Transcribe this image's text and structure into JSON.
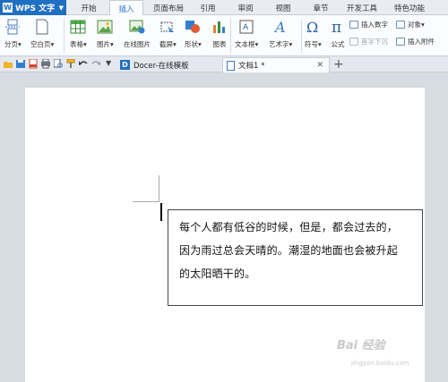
{
  "app": {
    "logo_text": "W",
    "name": "WPS 文字"
  },
  "menu_tabs": [
    "开始",
    "插入",
    "页面布局",
    "引用",
    "审阅",
    "视图",
    "章节",
    "开发工具",
    "特色功能"
  ],
  "active_menu_tab": "插入",
  "ribbon": {
    "page_break": "分页",
    "blank_page": "空白页",
    "table": "表格",
    "picture": "图片",
    "online_picture": "在线图片",
    "screenshot": "截屏",
    "shapes": "形状",
    "chart": "图表",
    "text_box": "文本框",
    "word_art": "艺术字",
    "symbol": "符号",
    "formula": "公式",
    "insert_number": "插入数字",
    "object": "对象",
    "drop_cap": "首字下沉",
    "attachment": "插入附件"
  },
  "doc_tabs": [
    {
      "label": "Docer-在线模板"
    },
    {
      "label": "文档1 *"
    }
  ],
  "document": {
    "lines": [
      "每个人都有低谷的时候，但是，都会过去的，",
      "因为雨过总会天晴的。潮湿的地面也会被升起",
      "的太阳晒干的。"
    ]
  },
  "watermark": {
    "main": "Bai 经验",
    "url": "jingyan.baidu.com"
  }
}
